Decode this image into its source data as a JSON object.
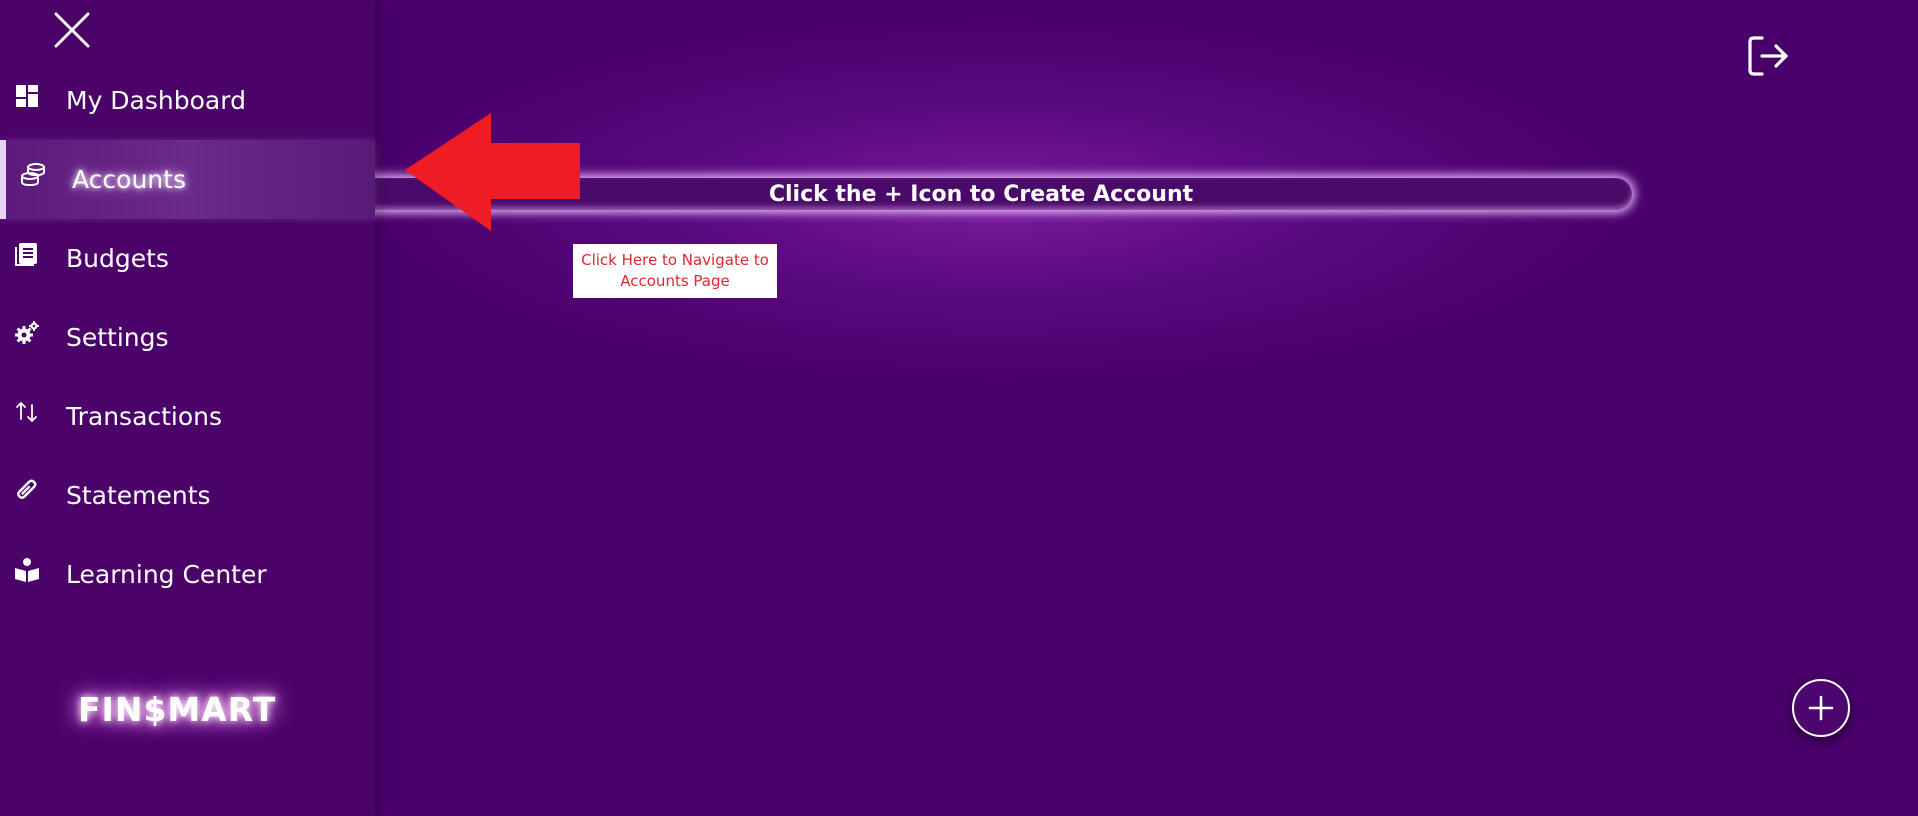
{
  "page": {
    "title_fragment": "s"
  },
  "banner": {
    "text": "Click the + Icon to Create Account"
  },
  "callout": {
    "text": "Click Here to Navigate to Accounts Page"
  },
  "sidebar": {
    "items": [
      {
        "label": "My Dashboard",
        "icon": "dashboard-icon"
      },
      {
        "label": "Accounts",
        "icon": "coins-icon",
        "active": true
      },
      {
        "label": "Budgets",
        "icon": "ledger-icon"
      },
      {
        "label": "Settings",
        "icon": "gears-icon"
      },
      {
        "label": "Transactions",
        "icon": "transfer-arrows-icon"
      },
      {
        "label": "Statements",
        "icon": "paperclip-icon"
      },
      {
        "label": "Learning Center",
        "icon": "reader-icon"
      }
    ],
    "logo": "FIN$MART"
  },
  "colors": {
    "background": "#4a006b",
    "sidebar": "#4b0269",
    "annotation_red": "#ee1c25",
    "callout_text": "#e0262e"
  }
}
